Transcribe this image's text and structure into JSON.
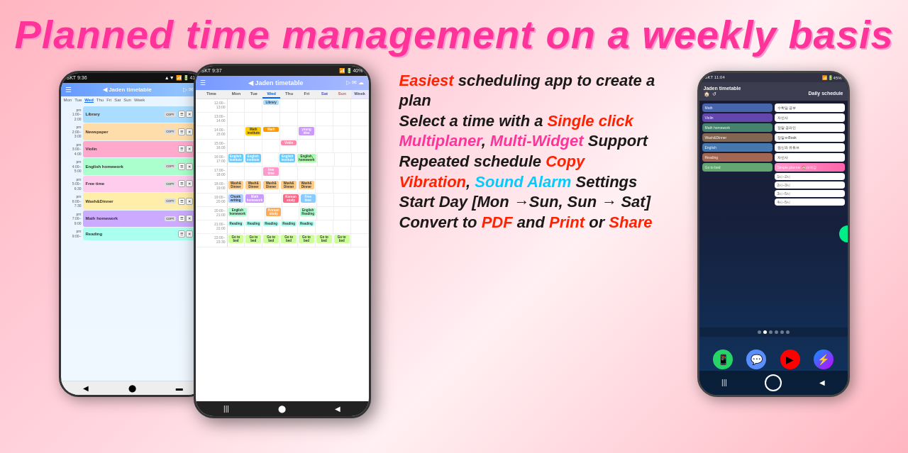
{
  "title": "Planned time management on a weekly basis",
  "features": [
    {
      "id": "feature-easiest",
      "parts": [
        {
          "text": "Easiest",
          "style": "highlight-red"
        },
        {
          "text": " scheduling app to create a plan",
          "style": "normal"
        }
      ]
    },
    {
      "id": "feature-single-click",
      "parts": [
        {
          "text": "Select a time with a ",
          "style": "normal"
        },
        {
          "text": "Single click",
          "style": "highlight-red"
        }
      ]
    },
    {
      "id": "feature-multiplaner",
      "parts": [
        {
          "text": "Multiplaner",
          "style": "highlight-pink"
        },
        {
          "text": ", ",
          "style": "normal"
        },
        {
          "text": "Multi-Widget",
          "style": "highlight-pink"
        },
        {
          "text": " Support",
          "style": "normal"
        }
      ]
    },
    {
      "id": "feature-copy",
      "parts": [
        {
          "text": "Repeated schedule ",
          "style": "normal"
        },
        {
          "text": "Copy",
          "style": "highlight-red"
        }
      ]
    },
    {
      "id": "feature-alarm",
      "parts": [
        {
          "text": "Vibration",
          "style": "highlight-red"
        },
        {
          "text": ", ",
          "style": "normal"
        },
        {
          "text": "Sound Alarm",
          "style": "highlight-cyan"
        },
        {
          "text": " Settings",
          "style": "normal"
        }
      ]
    },
    {
      "id": "feature-startday",
      "parts": [
        {
          "text": "Start Day [Mon →Sun, Sun → Sat]",
          "style": "normal"
        }
      ]
    },
    {
      "id": "feature-pdf",
      "parts": [
        {
          "text": "Convert to ",
          "style": "normal"
        },
        {
          "text": "PDF",
          "style": "highlight-red"
        },
        {
          "text": " and ",
          "style": "normal"
        },
        {
          "text": "Print",
          "style": "highlight-red"
        },
        {
          "text": " or ",
          "style": "normal"
        },
        {
          "text": "Share",
          "style": "highlight-red"
        }
      ]
    }
  ],
  "left_phone": {
    "status": "SKT 9:36",
    "title": "Jaden timetable",
    "active_day": "Wed",
    "days": [
      "Mon",
      "Tue",
      "Wed",
      "Thu",
      "Fri",
      "Sat",
      "Sun",
      "Week"
    ],
    "schedules": [
      {
        "name": "Library",
        "color": "#aaddff",
        "time": "pm 1:00~2:00"
      },
      {
        "name": "Newspaper",
        "color": "#ffddaa",
        "time": "pm 2:00~3:00"
      },
      {
        "name": "Violin",
        "color": "#ffaacc",
        "time": "pm 3:00~4:00"
      },
      {
        "name": "English homework",
        "color": "#aaffcc",
        "time": "pm 4:00~5:00"
      },
      {
        "name": "Free time",
        "color": "#ffccee",
        "time": "pm 5:00~6:30"
      },
      {
        "name": "Wash&Dinner",
        "color": "#ffeeaa",
        "time": "pm 6:00~7:30"
      },
      {
        "name": "Math homework",
        "color": "#ccaaff",
        "time": "pm 7:00~9:00"
      },
      {
        "name": "Reading",
        "color": "#aaffee",
        "time": "pm 9:00~"
      }
    ]
  },
  "center_phone": {
    "status": "SKT 9:37",
    "title": "Jaden timetable",
    "days": [
      "Mon",
      "Tue",
      "Wed",
      "Thu",
      "Fri",
      "Sat",
      "Sun",
      "Week"
    ],
    "times": [
      "12:00~13:00",
      "13:00~14:00",
      "14:00~15:00",
      "15:00~16:00",
      "16:00~17:00",
      "17:00~18:00",
      "18:00~19:00",
      "19:00~20:00",
      "20:00~21:00",
      "21:00~22:00",
      "22:00~23:30"
    ]
  },
  "right_phone": {
    "status": "SKT 11:04",
    "header_left": "Jaden timetable",
    "header_right": "Daily schedule",
    "items_left": [
      "Math",
      "Violin",
      "Math homework",
      "Wash&Dinner",
      "English",
      "Reading",
      "Go to bed"
    ],
    "items_right": [
      "수학일 공부",
      "자선사",
      "정말 공라인",
      "정말 e-Book",
      "원신와 유튜브",
      "자선사",
      "2시~2시",
      "2시~5시",
      "3시~5시",
      "4시~5시"
    ]
  },
  "colors": {
    "title": "#ff3399",
    "highlight_red": "#ff2200",
    "highlight_pink": "#ff3399",
    "highlight_cyan": "#00ccff",
    "background_from": "#ffb6c1",
    "background_to": "#ffd6e0"
  }
}
